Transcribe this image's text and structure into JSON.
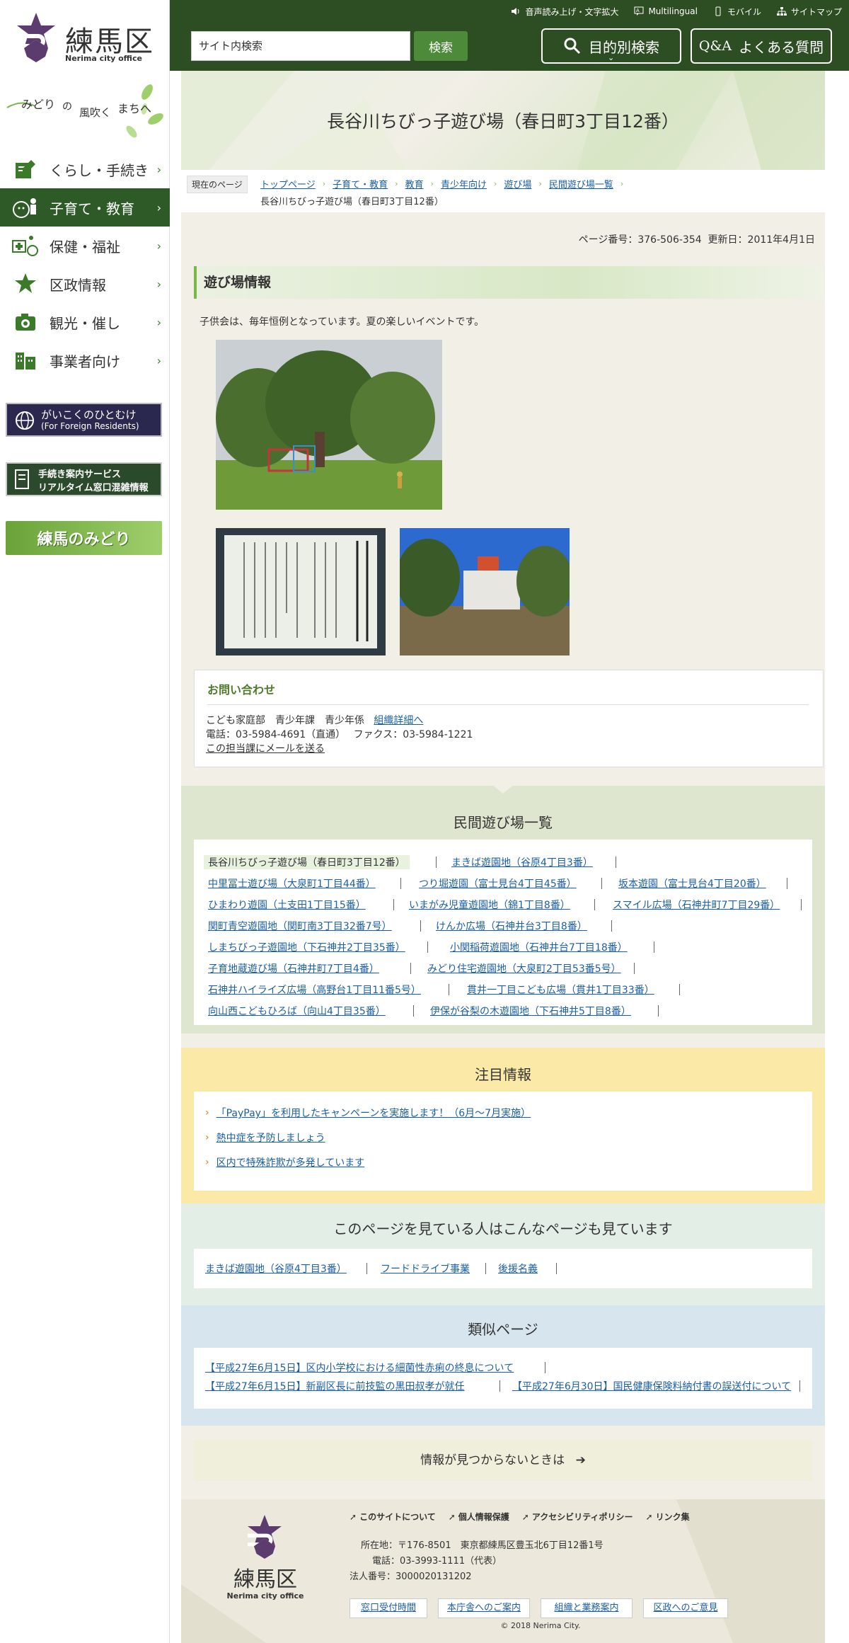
{
  "sidebar": {
    "logo": {
      "name": "練馬区",
      "sub": "Nerima city office"
    },
    "tagline": [
      "みどり",
      "の",
      "風吹く",
      "まちへ"
    ],
    "nav": [
      {
        "label": "くらし・手続き",
        "icon": "document-pen-icon"
      },
      {
        "label": "子育て・教育",
        "icon": "parent-child-icon"
      },
      {
        "label": "保健・福祉",
        "icon": "medical-wheelchair-icon"
      },
      {
        "label": "区政情報",
        "icon": "star-flag-icon"
      },
      {
        "label": "観光・催し",
        "icon": "camera-icon"
      },
      {
        "label": "事業者向け",
        "icon": "buildings-icon"
      }
    ],
    "banners": {
      "foreign": {
        "line1": "がいこくのひとむけ",
        "line2": "(For Foreign Residents)"
      },
      "procedure": {
        "line1": "手続き案内サービス",
        "line2": "リアルタイム窓口混雑情報"
      },
      "green": "練馬のみどり"
    }
  },
  "topbar": {
    "links": [
      "音声読み上げ・文字拡大",
      "Multilingual",
      "モバイル",
      "サイトマップ"
    ]
  },
  "header": {
    "search_placeholder": "サイト内検索",
    "search_button": "検索",
    "purpose_button": "目的別検索",
    "faq_prefix": "Q&A",
    "faq_label": "よくある質問"
  },
  "page": {
    "title": "長谷川ちびっ子遊び場（春日町3丁目12番）",
    "breadcrumb_here": "現在のページ",
    "breadcrumb": [
      "トップページ",
      "子育て・教育",
      "教育",
      "青少年向け",
      "遊び場",
      "民間遊び場一覧"
    ],
    "breadcrumb_current": "長谷川ちびっ子遊び場（春日町3丁目12番）",
    "page_number": "ページ番号：376-506-354",
    "updated": "更新日：2011年4月1日",
    "section_title": "遊び場情報",
    "description": "子供会は、毎年恒例となっています。夏の楽しいイベントです。"
  },
  "contact": {
    "title": "お問い合わせ",
    "dept": "こども家庭部　青少年課　青少年係",
    "dept_link": "組織詳細へ",
    "phone": "電話：03-5984-4691（直通）　 ファクス：03-5984-1221",
    "mail": "この担当課にメールを送る"
  },
  "playgrounds": {
    "title": "民間遊び場一覧",
    "rows": [
      [
        "長谷川ちびっ子遊び場（春日町3丁目12番）",
        "まきば遊園地（谷原4丁目3番）"
      ],
      [
        "中里冨士遊び場（大泉町1丁目44番）",
        "つり堀遊園（富士見台4丁目45番）",
        "坂本遊園（富士見台4丁目20番）"
      ],
      [
        "ひまわり遊園（土支田1丁目15番）",
        "いまがみ児童遊園地（錦1丁目8番）",
        "スマイル広場（石神井町7丁目29番）"
      ],
      [
        "関町青空遊園地（関町南3丁目32番7号）",
        "けんか広場（石神井台3丁目8番）"
      ],
      [
        "しまちびっ子遊園地（下石神井2丁目35番）",
        "小関稲荷遊園地（石神井台7丁目18番）"
      ],
      [
        "子育地蔵遊び場（石神井町7丁目4番）",
        "みどり住宅遊園地（大泉町2丁目53番5号）"
      ],
      [
        "石神井ハイライズ広場（高野台1丁目11番5号）",
        "貫井一丁目こども広場（貫井1丁目33番）"
      ],
      [
        "向山西こどもひろば（向山4丁目35番）",
        "伊保が谷梨の木遊園地（下石神井5丁目8番）"
      ]
    ]
  },
  "attention": {
    "title": "注目情報",
    "items": [
      "「PayPay」を利用したキャンペーンを実施します！（6月～7月実施）",
      "熱中症を予防しましょう",
      "区内で特殊詐欺が多発しています"
    ]
  },
  "also_viewed": {
    "title": "このページを見ている人はこんなページも見ています",
    "items": [
      "まきば遊園地（谷原4丁目3番）",
      "フードドライブ事業",
      "後援名義"
    ]
  },
  "similar": {
    "title": "類似ページ",
    "items": [
      "【平成27年6月15日】区内小学校における細菌性赤痢の終息について",
      "【平成27年6月15日】新副区長に前技監の黒田叔孝が就任",
      "【平成27年6月30日】国民健康保険料納付書の誤送付について"
    ]
  },
  "notfound": "情報が見つからないときは",
  "footer": {
    "logo_name": "練馬区",
    "logo_sub": "Nerima city office",
    "nav": [
      "このサイトについて",
      "個人情報保護",
      "アクセシビリティポリシー",
      "リンク集"
    ],
    "address": "所在地：〒176-8501　東京都練馬区豊玉北6丁目12番1号",
    "phone": "電話：03-3993-1111（代表）",
    "corp": "法人番号：3000020131202",
    "buttons": [
      "窓口受付時間",
      "本庁舎へのご案内",
      "組織と業務案内",
      "区政へのご意見"
    ],
    "copyright": "© 2018 Nerima City."
  },
  "colors": {
    "brand_dark": "#2d4d22",
    "accent_green": "#7ab648",
    "logo_purple": "#5c3b6e",
    "link": "#1a5fa6",
    "attention_band": "#fbe9a8"
  }
}
